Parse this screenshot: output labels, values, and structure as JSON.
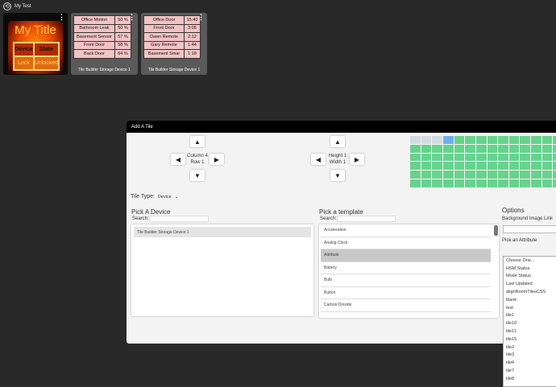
{
  "app": {
    "title": "My Test",
    "back_icon": "circle-arrow-icon"
  },
  "tiles": [
    {
      "type": "image",
      "title": "My Title",
      "grid": {
        "headers": [
          "Device",
          "State"
        ],
        "values": [
          "Lock",
          "Unlocked"
        ]
      }
    },
    {
      "rows": [
        [
          "Office Motion",
          "50 %"
        ],
        [
          "Bathroom Leak",
          "50 %"
        ],
        [
          "Basement Sensor",
          "57 %"
        ],
        [
          "Front Door",
          "58 %"
        ],
        [
          "Back Door",
          "64 %"
        ]
      ],
      "caption": "Tile Builder Storage Device 1"
    },
    {
      "rows": [
        [
          "Office Door",
          "15:40"
        ],
        [
          "Front Door",
          "3:05"
        ],
        [
          "Dawn Remote",
          "2:12"
        ],
        [
          "Gary Remote",
          "1:44"
        ],
        [
          "Basement Smar",
          "1:18"
        ]
      ],
      "caption": "Tile Builder Storage Device 1"
    }
  ],
  "dialog": {
    "title": "Add A Tile",
    "position": {
      "column_label": "Column 4",
      "row_label": "Row 1"
    },
    "size": {
      "height_label": "Height 1",
      "width_label": "Width 1"
    },
    "arrows": {
      "up": "▲",
      "down": "▼",
      "left": "◀",
      "right": "▶"
    },
    "tile_type": {
      "label": "Tile Type:",
      "value": "Device",
      "chevron_icon": "chevron-down-icon"
    },
    "device_section": {
      "title": "Pick A Device",
      "search_label": "Search:",
      "search_value": "",
      "devices": [
        "Tile Builder Storage Device 1"
      ]
    },
    "template_section": {
      "title": "Pick a template",
      "search_label": "Search:",
      "search_value": "",
      "templates": [
        "Acceleration",
        "Analog Clock",
        "Attribute",
        "Battery",
        "Bulb",
        "Button",
        "Carbon Dioxide"
      ],
      "selected": "Attribute"
    },
    "options_section": {
      "title": "Options",
      "background_image_label": "Background Image Link",
      "background_image_value": "",
      "attribute_label": "Pick an Attribute",
      "attributes": [
        "Choose One...",
        "HSM Status",
        "Mode Status",
        "Last Updated",
        "aligriRoomTilesCSS",
        "blank",
        "test",
        "tile1",
        "tile10",
        "tile11",
        "tile15",
        "tile2",
        "tile3",
        "tile4",
        "tile7",
        "tile8"
      ]
    },
    "colors": {
      "cell_filled": "#67d38d",
      "cell_selected": "#6fb0e8",
      "cell_empty": "#d3dbe2"
    }
  }
}
